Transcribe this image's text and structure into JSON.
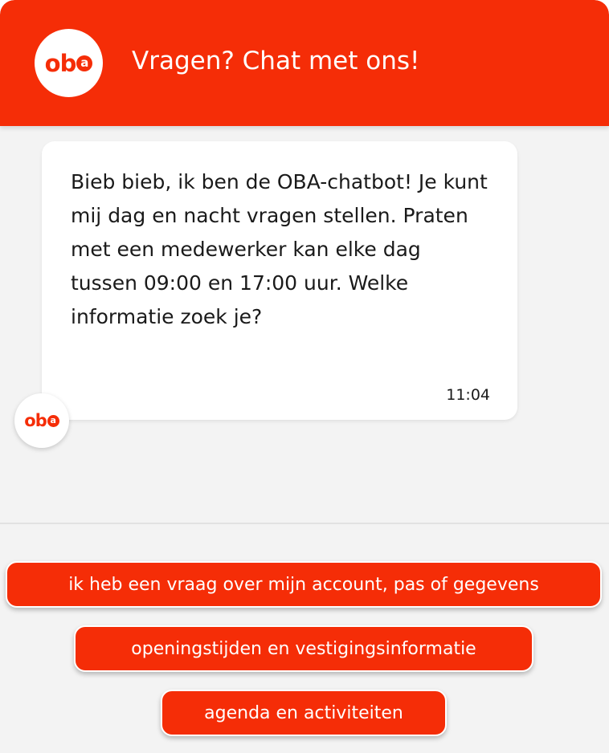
{
  "header": {
    "logo_text": "ob",
    "logo_mark": "a",
    "title": "Vragen? Chat met ons!"
  },
  "messages": [
    {
      "sender": "bot",
      "text": "Bieb bieb, ik ben de OBA-chatbot! Je kunt mij dag en nacht vragen stellen. Praten met een medewerker kan elke dag tussen 09:00 en 17:00 uur. Welke informatie zoek je?",
      "time": "11:04"
    }
  ],
  "bot_avatar": {
    "logo_text": "ob",
    "logo_mark": "a"
  },
  "quick_replies": [
    {
      "label": "ik heb een vraag over mijn account, pas of gegevens"
    },
    {
      "label": "openingstijden en vestigingsinformatie"
    },
    {
      "label": "agenda en activiteiten"
    }
  ],
  "colors": {
    "brand": "#f52d07",
    "background": "#f3f3f3",
    "bubble": "#ffffff"
  }
}
